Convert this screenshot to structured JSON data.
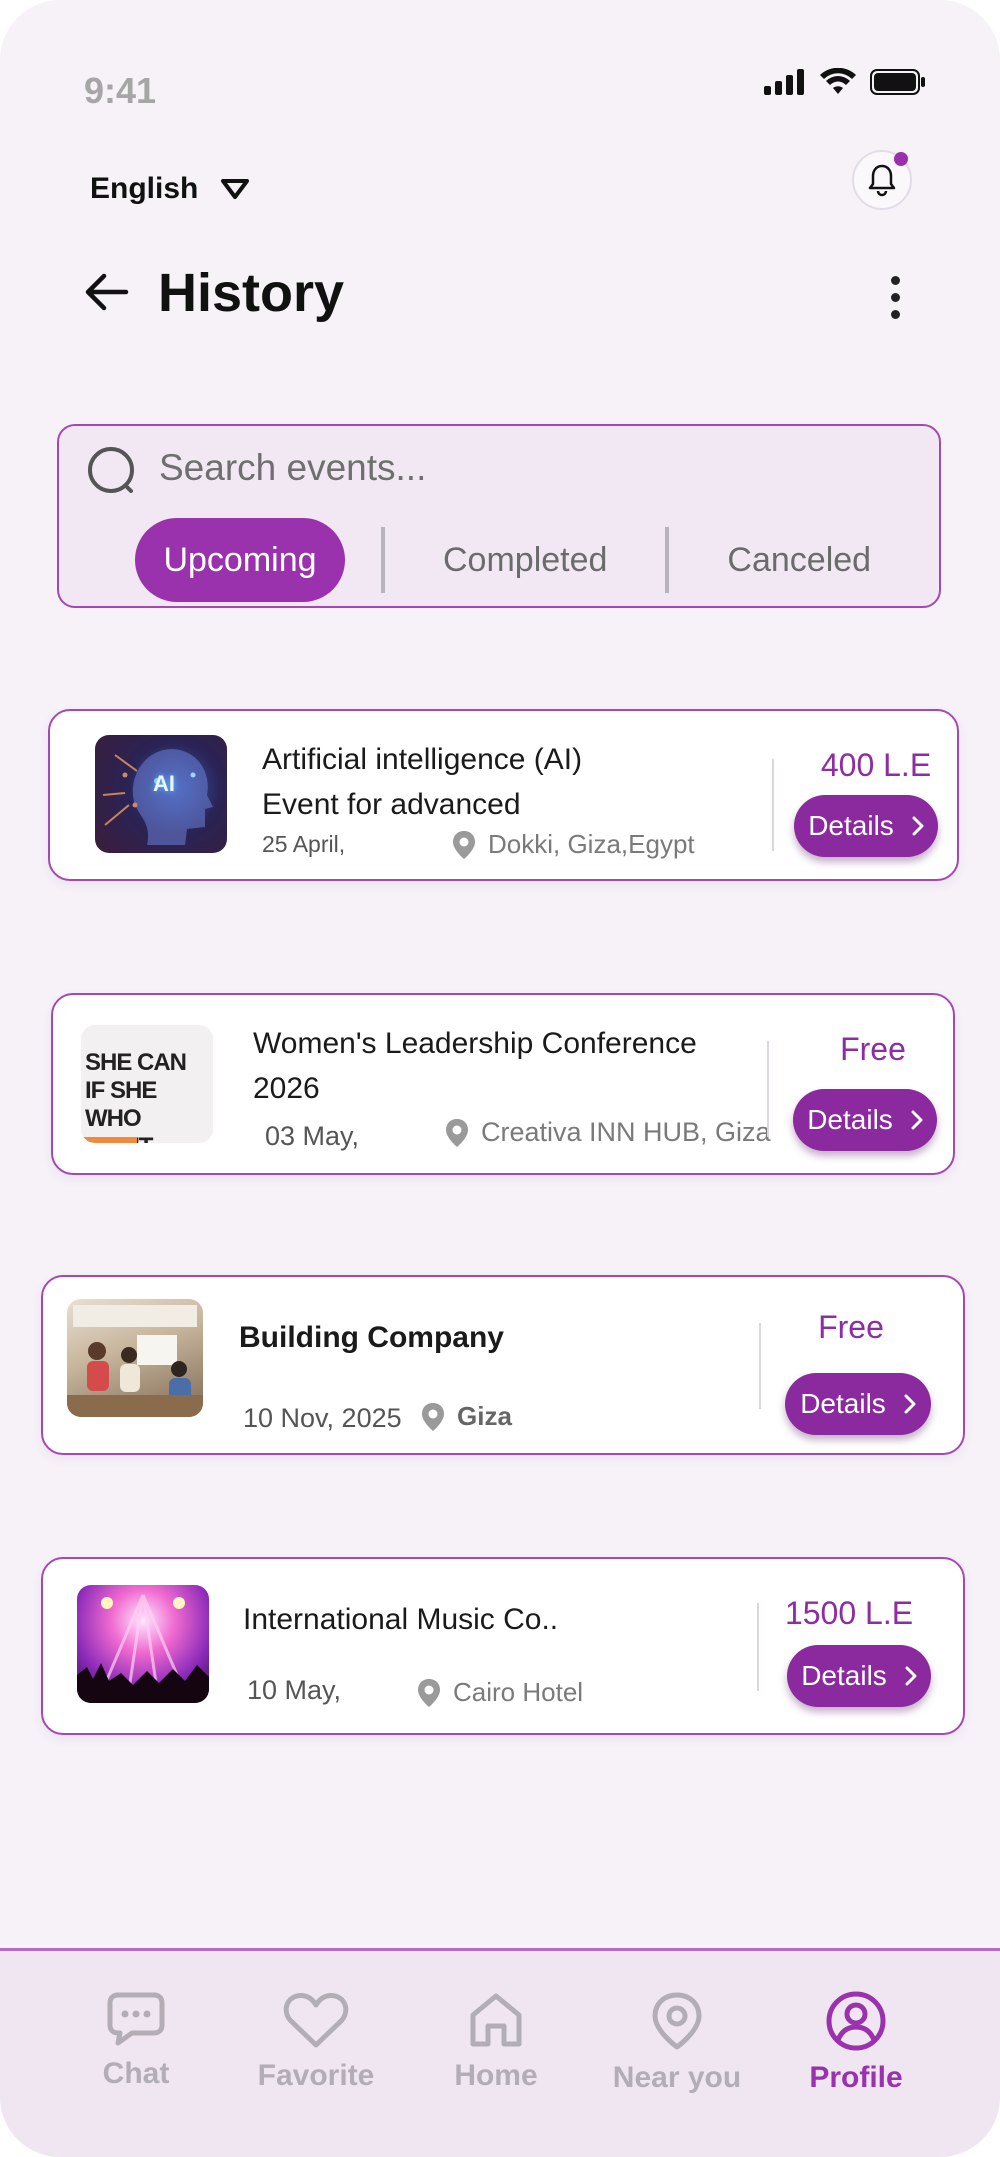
{
  "status_bar": {
    "time": "9:41"
  },
  "language": {
    "label": "English"
  },
  "header": {
    "title": "History"
  },
  "search": {
    "placeholder": "Search events...",
    "tabs": [
      {
        "label": "Upcoming",
        "active": true
      },
      {
        "label": "Completed",
        "active": false
      },
      {
        "label": "Canceled",
        "active": false
      }
    ]
  },
  "events": [
    {
      "title_line1": "Artificial intelligence (AI)",
      "title_line2": "Event for advanced",
      "date": "25 April,",
      "location": "Dokki, Giza,Egypt",
      "price": "400 L.E",
      "button": "Details",
      "image_text": "AI"
    },
    {
      "title_line1": "Women's Leadership Conference",
      "title_line2": "2026",
      "date": "03 May,",
      "location": "Creativa INN HUB, Giza",
      "price": "Free",
      "button": "Details",
      "image_text": "SHE CAN IF SHE WHO CAN'T"
    },
    {
      "title_line1": "Building Company",
      "title_line2": "",
      "date": "10 Nov, 2025",
      "location": "Giza",
      "price": "Free",
      "button": "Details"
    },
    {
      "title_line1": "International Music Co..",
      "title_line2": "",
      "date": "10 May,",
      "location": "Cairo Hotel",
      "price": "1500 L.E",
      "button": "Details"
    }
  ],
  "bottom_nav": [
    {
      "label": "Chat",
      "icon": "chat-icon",
      "active": false
    },
    {
      "label": "Favorite",
      "icon": "heart-icon",
      "active": false
    },
    {
      "label": "Home",
      "icon": "home-icon",
      "active": false
    },
    {
      "label": "Near you",
      "icon": "location-icon",
      "active": false
    },
    {
      "label": "Profile",
      "icon": "profile-icon",
      "active": true
    }
  ],
  "colors": {
    "accent": "#9a32ad",
    "button": "#8a2a9e",
    "background": "#f6f2f8"
  }
}
